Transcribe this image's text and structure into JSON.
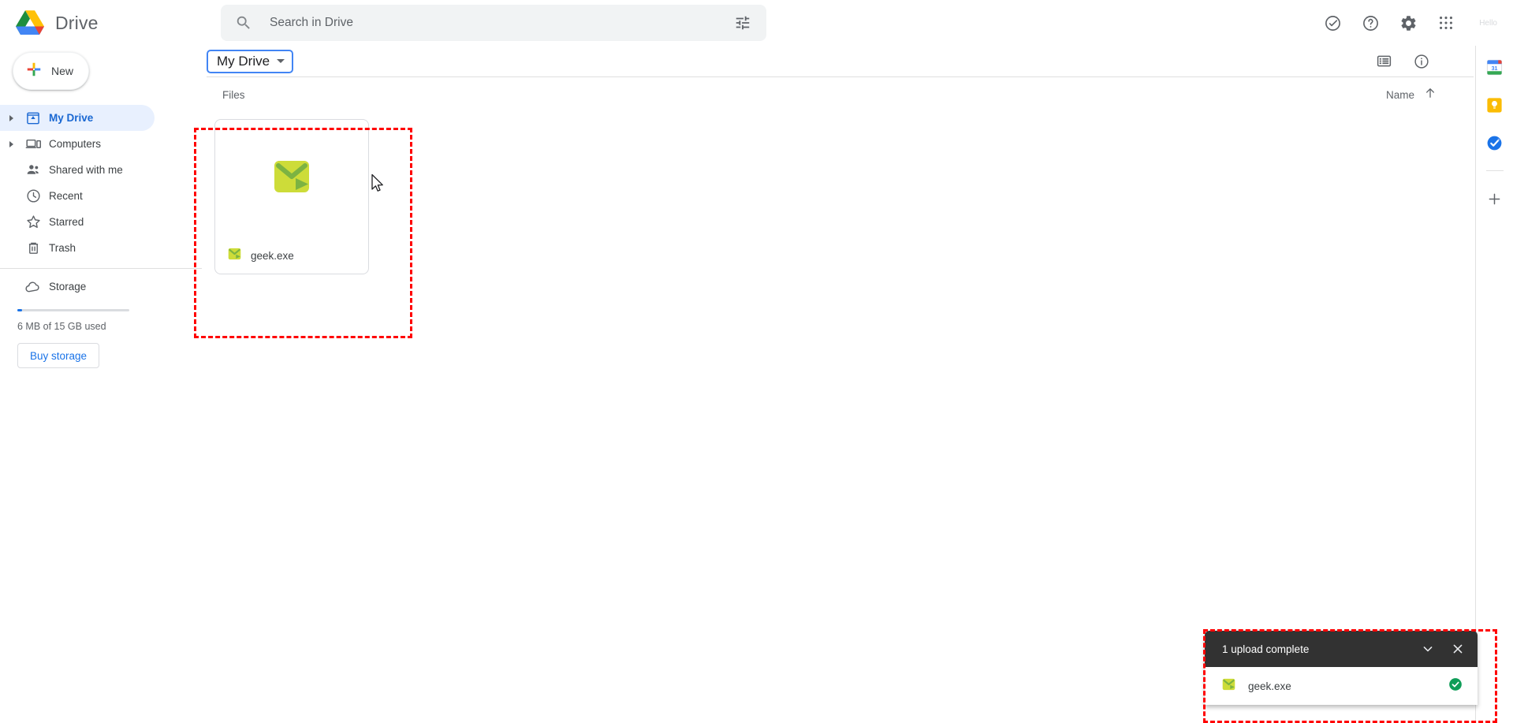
{
  "app": {
    "name": "Drive"
  },
  "search": {
    "placeholder": "Search in Drive",
    "value": "",
    "icon": "search-icon",
    "filter_icon": "tune-filter-icon"
  },
  "topbar": {
    "support_icon": "check-circle-icon",
    "help_icon": "help-circle-icon",
    "settings_icon": "gear-icon",
    "apps_icon": "apps-grid-icon",
    "account_text": "Hello"
  },
  "sidebar": {
    "new_button": {
      "label": "New",
      "icon": "plus-icon"
    },
    "items": [
      {
        "label": "My Drive",
        "icon": "my-drive-icon",
        "active": true,
        "expandable": true
      },
      {
        "label": "Computers",
        "icon": "computers-icon",
        "active": false,
        "expandable": true
      },
      {
        "label": "Shared with me",
        "icon": "shared-with-me-icon",
        "active": false,
        "expandable": false
      },
      {
        "label": "Recent",
        "icon": "clock-icon",
        "active": false,
        "expandable": false
      },
      {
        "label": "Starred",
        "icon": "star-icon",
        "active": false,
        "expandable": false
      },
      {
        "label": "Trash",
        "icon": "trash-icon",
        "active": false,
        "expandable": false
      },
      {
        "label": "Storage",
        "icon": "cloud-icon",
        "active": false,
        "expandable": false
      }
    ],
    "storage": {
      "used_text": "6 MB of 15 GB used",
      "percent": 0.04,
      "buy_label": "Buy storage",
      "bar_color": "#1a73e8"
    }
  },
  "breadcrumb": {
    "label": "My Drive",
    "caret_icon": "chevron-down-icon",
    "focus_color": "#4285f4"
  },
  "toolbar": {
    "list_view_icon": "list-view-icon",
    "details_icon": "info-circle-icon"
  },
  "content": {
    "section_label": "Files",
    "sort": {
      "label": "Name",
      "direction_icon": "arrow-up-icon"
    },
    "files": [
      {
        "name": "geek.exe",
        "icon": "exe-envelope-play-icon",
        "icon_color": "#cddc39",
        "icon_accent": "#7cb342"
      }
    ]
  },
  "right_rail": {
    "items": [
      {
        "name": "google-calendar-icon",
        "label": "31"
      },
      {
        "name": "google-keep-icon",
        "label": ""
      },
      {
        "name": "google-tasks-icon",
        "label": ""
      }
    ],
    "add_label": "+",
    "add_icon": "plus-icon"
  },
  "toast": {
    "title": "1 upload complete",
    "collapse_icon": "chevron-down-icon",
    "close_icon": "close-icon",
    "rows": [
      {
        "name": "geek.exe",
        "icon": "exe-envelope-play-icon",
        "status_icon": "check-circle-filled-icon",
        "status_color": "#0f9d58"
      }
    ]
  },
  "annotations": {
    "color": "#ff0000",
    "targets": [
      "file-card",
      "upload-toast"
    ]
  }
}
